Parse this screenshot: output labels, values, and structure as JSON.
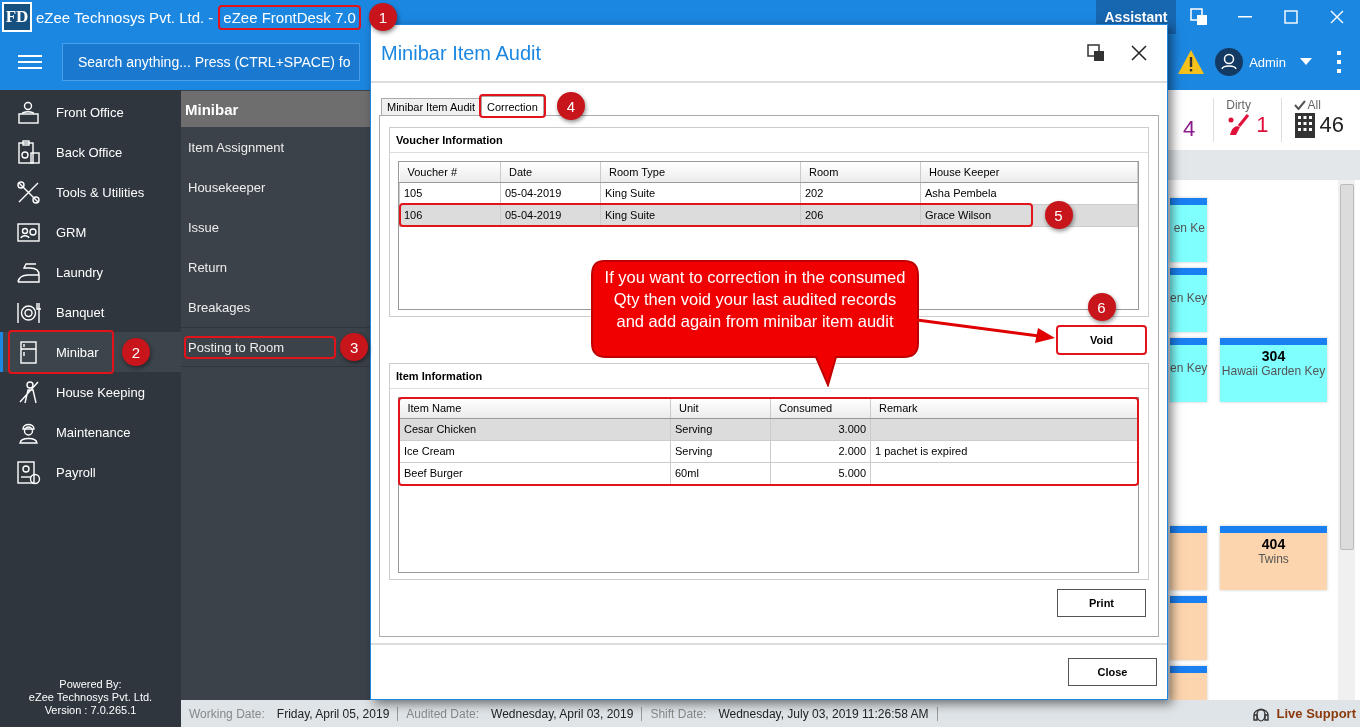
{
  "window": {
    "logo": "FD",
    "company": "eZee Technosys Pvt. Ltd. -",
    "product": "eZee FrontDesk 7.0",
    "assistant": "Assistant"
  },
  "toolbar": {
    "search_placeholder": "Search anything... Press (CTRL+SPACE) fo",
    "user": "Admin"
  },
  "sidebar": {
    "items": [
      {
        "label": "Front Office",
        "selected": false
      },
      {
        "label": "Back Office",
        "selected": false
      },
      {
        "label": "Tools & Utilities",
        "selected": false
      },
      {
        "label": "GRM",
        "selected": false
      },
      {
        "label": "Laundry",
        "selected": false
      },
      {
        "label": "Banquet",
        "selected": false
      },
      {
        "label": "Minibar",
        "selected": true
      },
      {
        "label": "House Keeping",
        "selected": false
      },
      {
        "label": "Maintenance",
        "selected": false
      },
      {
        "label": "Payroll",
        "selected": false
      }
    ],
    "footer": [
      "Powered By:",
      "eZee Technosys Pvt. Ltd.",
      "Version : 7.0.265.1"
    ]
  },
  "submenu": {
    "title": "Minibar",
    "items": [
      "Item Assignment",
      "Housekeeper",
      "Issue",
      "Return",
      "Breakages",
      "Posting to Room"
    ]
  },
  "stats": [
    {
      "kind": "count",
      "value": "4",
      "color": "#8b1a8b"
    },
    {
      "kind": "dirty",
      "label": "Dirty",
      "value": "1",
      "color": "#e0103a"
    },
    {
      "kind": "all",
      "label": "All",
      "value": "46",
      "color": "#222222"
    }
  ],
  "room_grid": {
    "floors": [
      {
        "rows": [
          {
            "left": {
              "label": "en Ke",
              "color": "#80ffff"
            }
          },
          {
            "left": {
              "label": "en Key",
              "color": "#80ffff"
            }
          },
          {
            "left": {
              "label": "en Key",
              "color": "#80ffff"
            },
            "right": {
              "number": "304",
              "label": "Hawaii Garden Key",
              "color": "#80ffff"
            }
          }
        ]
      },
      {
        "rows": [
          {
            "left": {
              "color": "#fcd5ae"
            },
            "right": {
              "number": "404",
              "label": "Twins",
              "color": "#fcd5ae"
            }
          },
          {
            "left": {
              "color": "#fcd5ae"
            }
          },
          {
            "left": {
              "color": "#fcd5ae"
            }
          }
        ]
      }
    ]
  },
  "status_bar": [
    {
      "label": "Working Date:",
      "value": "Friday, April 05, 2019"
    },
    {
      "label": "Audited Date:",
      "value": "Wednesday, April 03, 2019"
    },
    {
      "label": "Shift Date:",
      "value": "Wednesday, July 03, 2019 11:26:58 AM"
    }
  ],
  "live_support": "Live Support",
  "dialog": {
    "title": "Minibar Item Audit",
    "tabs": [
      {
        "label": "Minibar Item Audit",
        "selected": false
      },
      {
        "label": "Correction",
        "selected": true
      }
    ],
    "voucher": {
      "title": "Voucher  Information",
      "columns": [
        "Voucher #",
        "Date",
        "Room Type",
        "Room",
        "House Keeper"
      ],
      "rows": [
        {
          "cells": [
            "105",
            "05-04-2019",
            "King Suite",
            "202",
            "Asha Pembela"
          ],
          "selected": false
        },
        {
          "cells": [
            "106",
            "05-04-2019",
            "King Suite",
            "206",
            "Grace Wilson"
          ],
          "selected": true
        }
      ]
    },
    "void_button": "Void",
    "items": {
      "title": "Item Information",
      "columns": [
        "Item Name",
        "Unit",
        "Consumed",
        "Remark"
      ],
      "rows": [
        {
          "cells": [
            "Cesar Chicken",
            "Serving",
            "3.000"
          ],
          "selected": true
        },
        {
          "cells": [
            "Ice Cream",
            "Serving",
            "2.000",
            "1 pachet is expired"
          ],
          "selected": false
        },
        {
          "cells": [
            "Beef Burger",
            "60ml",
            "5.000"
          ],
          "selected": false
        }
      ]
    },
    "print_button": "Print",
    "close_button": "Close"
  },
  "annotations": [
    {
      "kind": "numbered",
      "number": "1"
    },
    {
      "kind": "numbered",
      "number": "2"
    },
    {
      "kind": "numbered",
      "number": "3"
    },
    {
      "kind": "numbered",
      "number": "4"
    },
    {
      "kind": "numbered",
      "number": "5"
    },
    {
      "kind": "numbered",
      "number": "6"
    },
    {
      "kind": "frame"
    }
  ],
  "callout": "If you want to correction in the consumed Qty then void your last audited records and add again from minibar item audit"
}
